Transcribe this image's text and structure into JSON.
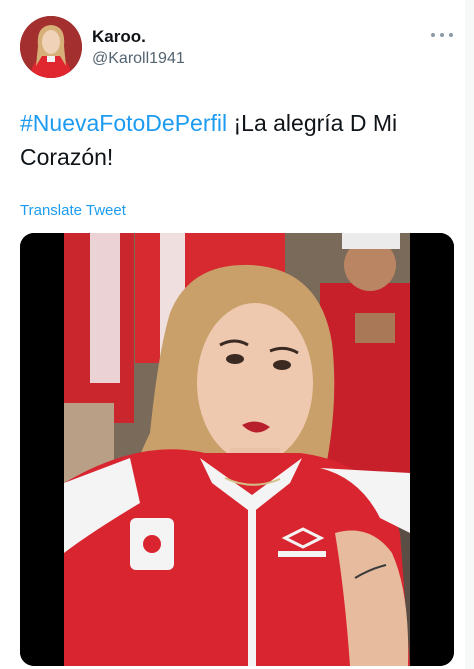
{
  "user": {
    "display_name": "Karoo.",
    "handle": "@Karoll1941",
    "avatar_icon": "profile-photo"
  },
  "menu": {
    "icon": "more-dots-icon"
  },
  "tweet": {
    "hashtag": "#NuevaFotoDePerfil",
    "text": " ¡La alegría D Mi Corazón!",
    "translate_label": "Translate Tweet"
  },
  "media": {
    "kind": "photo",
    "jersey_brand": "umbro",
    "tattoo_text": "Bendiciones"
  },
  "colors": {
    "link": "#1d9bf0",
    "secondary_text": "#536471",
    "jersey_red": "#d9252f"
  }
}
